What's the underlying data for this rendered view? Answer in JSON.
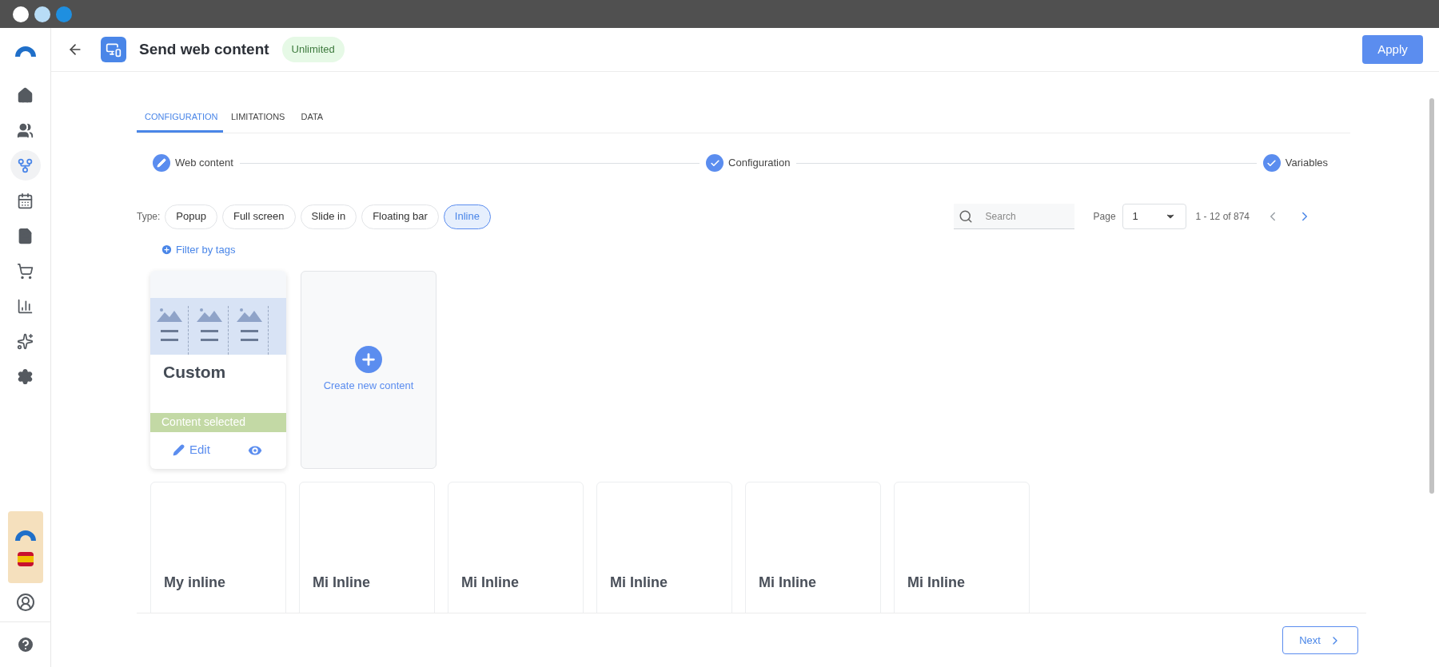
{
  "header": {
    "title": "Send web content",
    "badge": "Unlimited",
    "apply": "Apply"
  },
  "sidebar": {
    "items": [
      {
        "selected": false
      },
      {
        "selected": false
      },
      {
        "selected": true
      },
      {
        "selected": false
      },
      {
        "selected": false
      },
      {
        "selected": false
      },
      {
        "selected": false
      },
      {
        "selected": false
      },
      {
        "selected": false
      }
    ]
  },
  "tabs": [
    {
      "label": "CONFIGURATION",
      "selected": true
    },
    {
      "label": "LIMITATIONS",
      "selected": false
    },
    {
      "label": "DATA",
      "selected": false
    }
  ],
  "steps": [
    {
      "label": "Web content",
      "kind": "edit"
    },
    {
      "label": "Configuration",
      "kind": "done"
    },
    {
      "label": "Variables",
      "kind": "done"
    }
  ],
  "filters": {
    "type_label": "Type:",
    "types": [
      {
        "label": "Popup",
        "selected": false
      },
      {
        "label": "Full screen",
        "selected": false
      },
      {
        "label": "Slide in",
        "selected": false
      },
      {
        "label": "Floating bar",
        "selected": false
      },
      {
        "label": "Inline",
        "selected": true
      }
    ],
    "filter_by_tags": "Filter by tags"
  },
  "pagination": {
    "search_placeholder": "Search",
    "page_label": "Page",
    "page": "1",
    "range": "1 - 12 of 874",
    "prev_disabled": true,
    "next_disabled": false
  },
  "cards": [
    {
      "kind": "content",
      "title": "Custom",
      "status": "Content selected",
      "edit": "Edit"
    },
    {
      "kind": "create",
      "label": "Create new content"
    },
    {
      "kind": "inline",
      "title": "My inline"
    },
    {
      "kind": "inline",
      "title": "Mi Inline"
    },
    {
      "kind": "inline",
      "title": "Mi Inline"
    },
    {
      "kind": "inline",
      "title": "Mi Inline"
    },
    {
      "kind": "inline",
      "title": "Mi Inline"
    },
    {
      "kind": "inline",
      "title": "Mi Inline"
    }
  ],
  "footer": {
    "next": "Next"
  }
}
